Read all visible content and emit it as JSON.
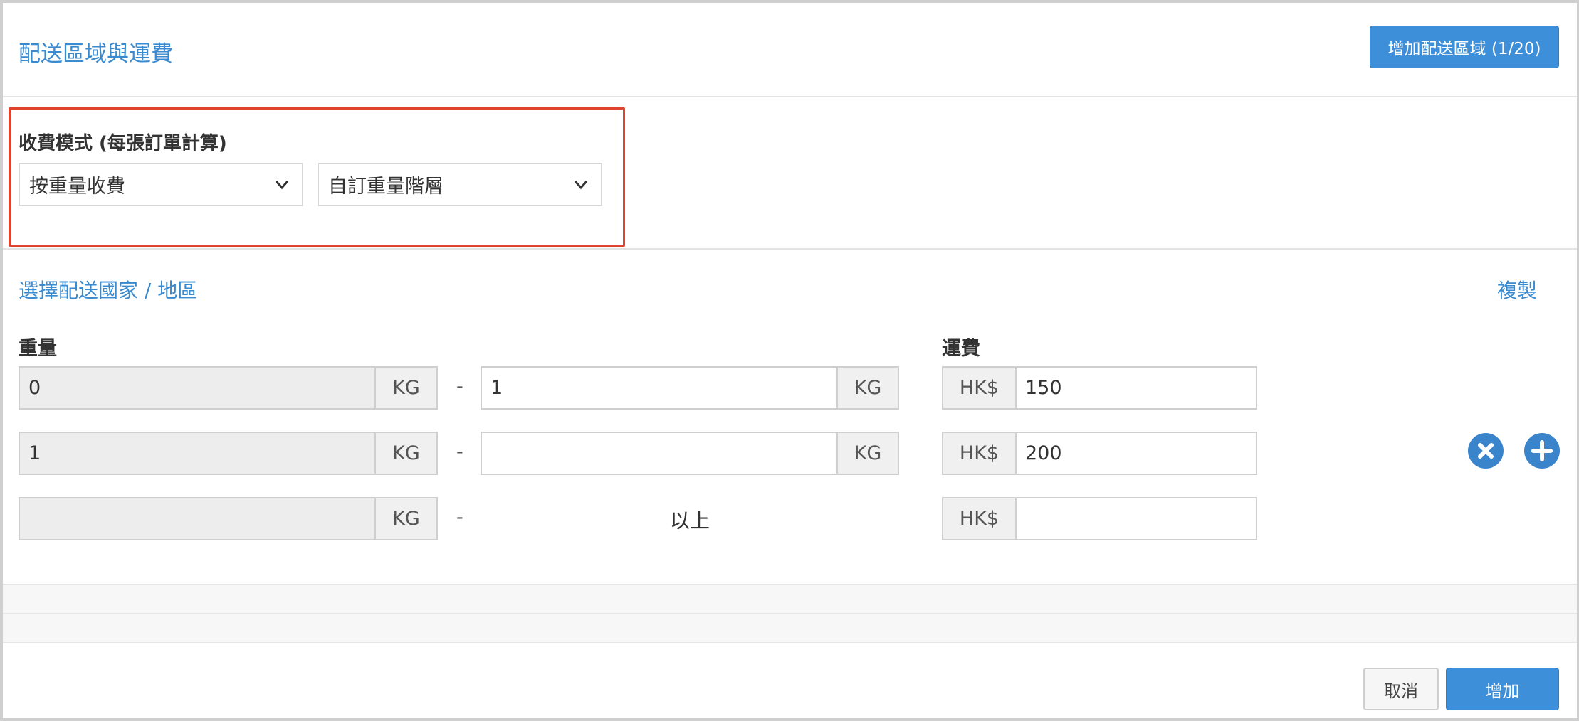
{
  "header": {
    "title": "配送區域與運費",
    "add_zone_label": "增加配送區域 (1/20)"
  },
  "charge_mode": {
    "label": "收費模式 (每張訂單計算)",
    "mode_select": "按重量收費",
    "tier_select": "自訂重量階層"
  },
  "region": {
    "select_link": "選擇配送國家 / 地區",
    "copy_link": "複製"
  },
  "columns": {
    "weight": "重量",
    "fee": "運費"
  },
  "tiers": [
    {
      "from": "0",
      "from_unit": "KG",
      "separator": "-",
      "to": "1",
      "to_unit": "KG",
      "currency": "HK$",
      "fee": "150"
    },
    {
      "from": "1",
      "from_unit": "KG",
      "separator": "-",
      "to": "",
      "to_unit": "KG",
      "currency": "HK$",
      "fee": "200"
    },
    {
      "from": "",
      "from_unit": "KG",
      "separator": "-",
      "above_label": "以上",
      "currency": "HK$",
      "fee": ""
    }
  ],
  "footer": {
    "cancel_label": "取消",
    "add_label": "增加"
  },
  "colors": {
    "accent": "#3d8fd9",
    "link": "#3a8ad0",
    "highlight_border": "#e0442e"
  },
  "icons": {
    "remove": "remove-circle-icon",
    "add": "add-circle-icon",
    "dropdown": "chevron-down-icon"
  }
}
